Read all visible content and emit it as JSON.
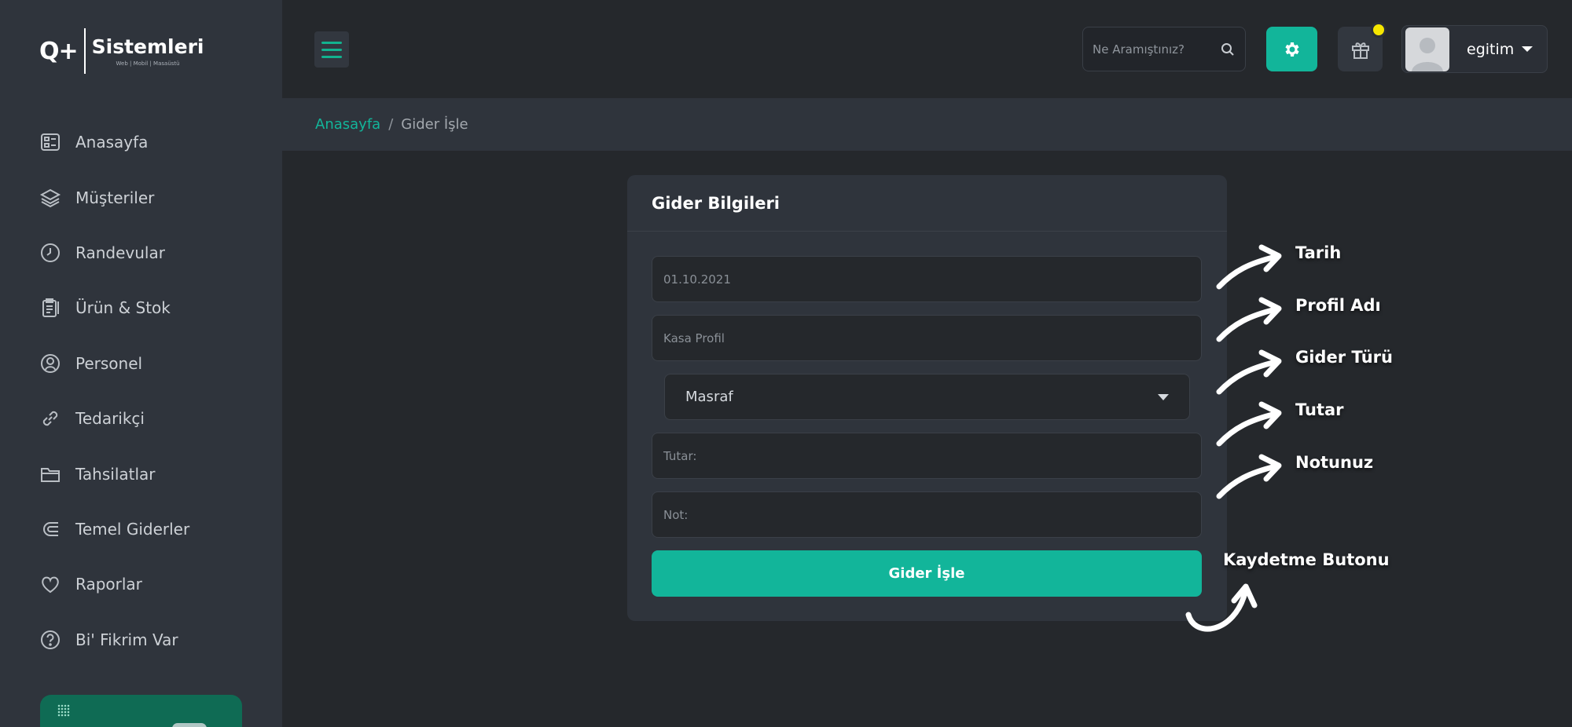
{
  "sidebar": {
    "logo": {
      "mark": "Q+",
      "title": "Sistemleri",
      "subtitle": "Web | Mobil | Masaüstü"
    },
    "items": [
      {
        "label": "Anasayfa",
        "icon": "dashboard-icon"
      },
      {
        "label": "Müşteriler",
        "icon": "layers-icon"
      },
      {
        "label": "Randevular",
        "icon": "clock-icon"
      },
      {
        "label": "Ürün & Stok",
        "icon": "clipboard-icon"
      },
      {
        "label": "Personel",
        "icon": "user-circle-icon"
      },
      {
        "label": "Tedarikçi",
        "icon": "link-icon"
      },
      {
        "label": "Tahsilatlar",
        "icon": "folder-icon"
      },
      {
        "label": "Temel Giderler",
        "icon": "magnet-icon"
      },
      {
        "label": "Raporlar",
        "icon": "heart-icon"
      },
      {
        "label": "Bi' Fikrim Var",
        "icon": "question-icon"
      }
    ]
  },
  "header": {
    "search_placeholder": "Ne Aramıştınız?",
    "username": "egitim",
    "accent_color": "#12b59a",
    "notification_color": "#f5e600"
  },
  "breadcrumb": {
    "home": "Anasayfa",
    "separator": "/",
    "current": "Gider İşle"
  },
  "form": {
    "title": "Gider Bilgileri",
    "date_placeholder": "01.10.2021",
    "profile_placeholder": "Kasa Profil",
    "type_value": "Masraf",
    "amount_placeholder": "Tutar:",
    "note_placeholder": "Not:",
    "submit_label": "Gider İşle"
  },
  "annotations": {
    "date": "Tarih",
    "profile": "Profil Adı",
    "type": "Gider Türü",
    "amount": "Tutar",
    "note": "Notunuz",
    "submit": "Kaydetme Butonu"
  }
}
